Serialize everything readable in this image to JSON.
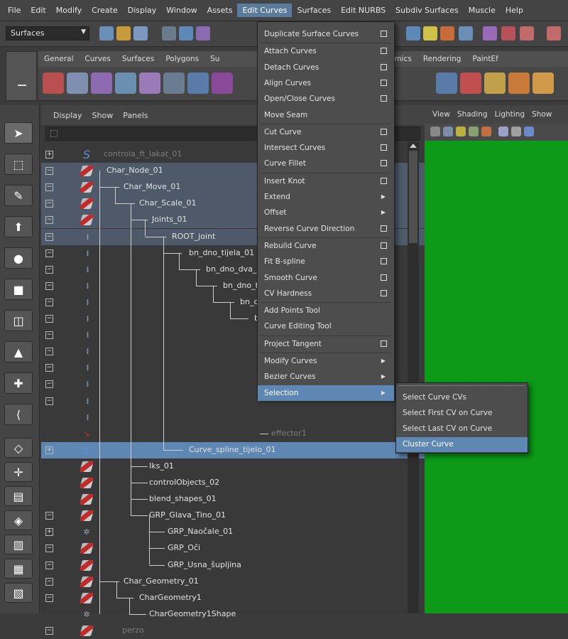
{
  "menubar": [
    "File",
    "Edit",
    "Modify",
    "Create",
    "Display",
    "Window",
    "Assets",
    "Edit Curves",
    "Surfaces",
    "Edit NURBS",
    "Subdiv Surfaces",
    "Muscle",
    "Help"
  ],
  "menubar_active": "Edit Curves",
  "status": {
    "mode": "Surfaces"
  },
  "shelf_tabs": [
    "General",
    "Curves",
    "Surfaces",
    "Polygons",
    "Su",
    "n",
    "Dynamics",
    "Rendering",
    "PaintEf"
  ],
  "outliner_menu": [
    "Display",
    "Show",
    "Panels"
  ],
  "viewport_menu": [
    "View",
    "Shading",
    "Lighting",
    "Show"
  ],
  "outliner_rows": [
    {
      "label": "controla_ft_lakat_01",
      "icon": "curve-icon",
      "dim": true
    },
    {
      "label": "Char_Node_01",
      "icon": "transform-icon"
    },
    {
      "label": "Char_Move_01",
      "icon": "transform-icon"
    },
    {
      "label": "Char_Scale_01",
      "icon": "transform-icon"
    },
    {
      "label": "Joints_01",
      "icon": "transform-icon"
    },
    {
      "label": "ROOT_joint",
      "icon": "joint-icon"
    },
    {
      "label": "bn_dno_tijela_01",
      "icon": "joint-icon"
    },
    {
      "label": "bn_dno_dva_C",
      "icon": "joint-icon"
    },
    {
      "label": "bn_dno_tr",
      "icon": "joint-icon"
    },
    {
      "label": "bn_dn",
      "icon": "joint-icon"
    },
    {
      "label": "br",
      "icon": "joint-icon"
    },
    {
      "label": "",
      "icon": "joint-icon"
    },
    {
      "label": "",
      "icon": "joint-icon"
    },
    {
      "label": "",
      "icon": "joint-icon"
    },
    {
      "label": "",
      "icon": "joint-icon"
    },
    {
      "label": "",
      "icon": "joint-icon"
    },
    {
      "label": "",
      "icon": "joint-icon"
    },
    {
      "label": "effector1",
      "icon": "effector-icon",
      "dim": true
    },
    {
      "label": "Curve_spline_tijelo_01",
      "icon": "curve-icon"
    },
    {
      "label": "Iks_01",
      "icon": "transform-icon"
    },
    {
      "label": "controlObjects_02",
      "icon": "transform-icon"
    },
    {
      "label": "blend_shapes_01",
      "icon": "transform-icon"
    },
    {
      "label": "GRP_Glava_Tino_01",
      "icon": "transform-icon"
    },
    {
      "label": "GRP_Naočale_01",
      "icon": "shape-icon"
    },
    {
      "label": "GRP_Oči",
      "icon": "transform-icon"
    },
    {
      "label": "GRP_Usna_šupljina",
      "icon": "transform-icon"
    },
    {
      "label": "Char_Geometry_01",
      "icon": "transform-icon"
    },
    {
      "label": "CharGeometry1",
      "icon": "transform-icon"
    },
    {
      "label": "CharGeometry1Shape",
      "icon": "shape-icon"
    },
    {
      "label": "perzo",
      "icon": "transform-icon",
      "dim": true
    }
  ],
  "dropdown": [
    {
      "label": "Duplicate Surface Curves",
      "opt": true
    },
    {
      "label": "Attach Curves",
      "opt": true
    },
    {
      "label": "Detach Curves",
      "opt": true
    },
    {
      "label": "Align Curves",
      "opt": true
    },
    {
      "label": "Open/Close Curves",
      "opt": true
    },
    {
      "label": "Move Seam"
    },
    {
      "label": "Cut Curve",
      "opt": true
    },
    {
      "label": "Intersect Curves",
      "opt": true
    },
    {
      "label": "Curve Fillet",
      "opt": true
    },
    {
      "label": "Insert Knot",
      "opt": true
    },
    {
      "label": "Extend",
      "sub": true
    },
    {
      "label": "Offset",
      "sub": true
    },
    {
      "label": "Reverse Curve Direction",
      "opt": true
    },
    {
      "label": "Rebuild Curve",
      "opt": true
    },
    {
      "label": "Fit B-spline",
      "opt": true
    },
    {
      "label": "Smooth Curve",
      "opt": true
    },
    {
      "label": "CV Hardness",
      "opt": true
    },
    {
      "label": "Add Points Tool"
    },
    {
      "label": "Curve Editing Tool"
    },
    {
      "label": "Project Tangent",
      "opt": true
    },
    {
      "label": "Modify Curves",
      "sub": true
    },
    {
      "label": "Bezier Curves",
      "sub": true
    },
    {
      "label": "Selection",
      "sub": true,
      "highlighted": true
    }
  ],
  "submenu": [
    {
      "label": "Select Curve CVs"
    },
    {
      "label": "Select First CV on Curve"
    },
    {
      "label": "Select Last CV on Curve"
    },
    {
      "label": "Cluster Curve",
      "highlighted": true
    }
  ],
  "colors": {
    "viewport_green": "#0c9a18",
    "highlight_blue": "#5e87b4",
    "selected_row": "#4e5a6a"
  }
}
